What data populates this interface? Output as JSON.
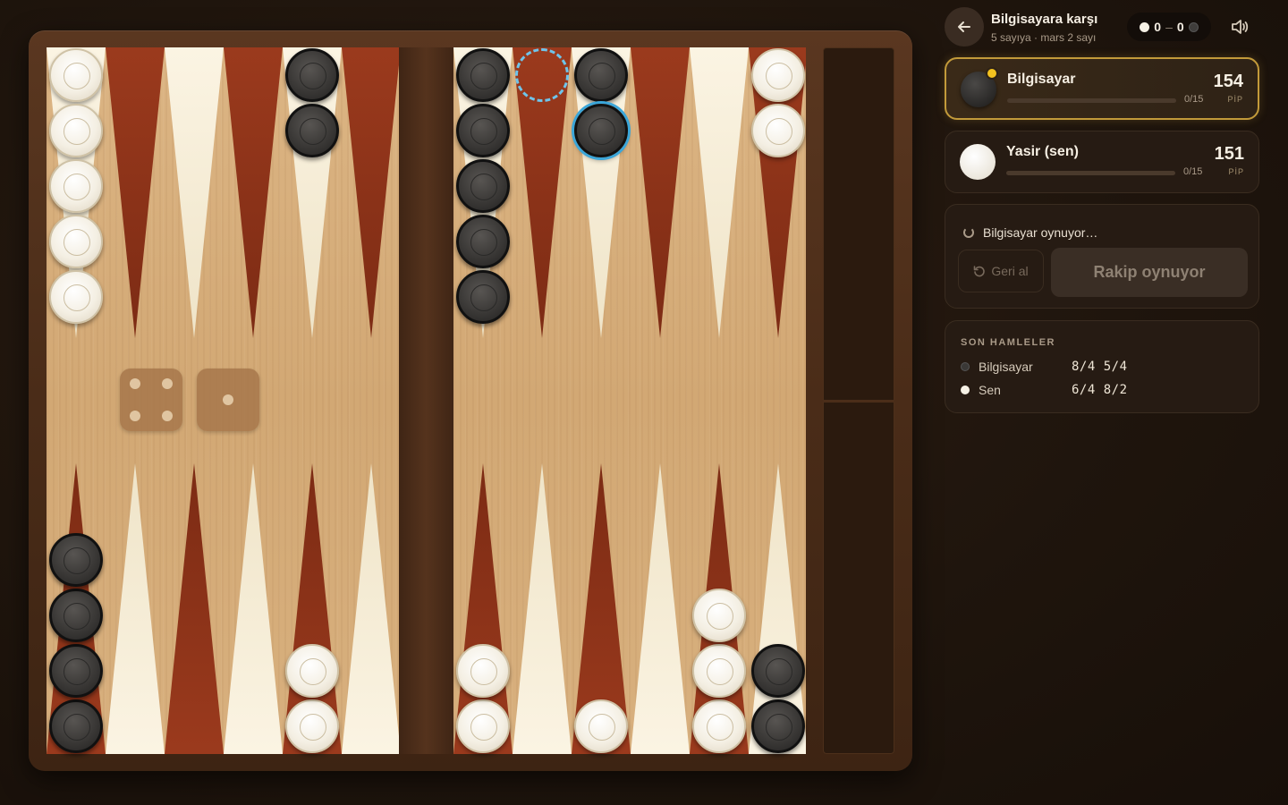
{
  "header": {
    "title": "Bilgisayara karşı",
    "subtitle": "5 sayıya · mars 2 sayı",
    "score_white": "0",
    "score_sep": "–",
    "score_black": "0"
  },
  "players": [
    {
      "name": "Bilgisayar",
      "color": "black",
      "pips": "154",
      "pip_label": "PİP",
      "borne_off": "0/15",
      "borne_fraction": 0,
      "active": true
    },
    {
      "name": "Yasir (sen)",
      "color": "white",
      "pips": "151",
      "pip_label": "PİP",
      "borne_off": "0/15",
      "borne_fraction": 0,
      "active": false
    }
  ],
  "status": {
    "text": "Bilgisayar oynuyor…",
    "undo_label": "Geri al",
    "main_button_label": "Rakip oynuyor"
  },
  "recent_moves": {
    "title": "SON HAMLELER",
    "rows": [
      {
        "player": "Bilgisayar",
        "color": "black",
        "move": "8/4 5/4"
      },
      {
        "player": "Sen",
        "color": "white",
        "move": "6/4 8/2"
      }
    ]
  },
  "dice": [
    4,
    1
  ],
  "board": {
    "top_row": [
      {
        "color": "white",
        "count": 5
      },
      {
        "color": null,
        "count": 0
      },
      {
        "color": null,
        "count": 0
      },
      {
        "color": null,
        "count": 0
      },
      {
        "color": "black",
        "count": 2
      },
      {
        "color": null,
        "count": 0
      },
      {
        "color": "black",
        "count": 5
      },
      {
        "color": null,
        "count": 0,
        "ghost": true
      },
      {
        "color": "black",
        "count": 2,
        "selected_index": 1
      },
      {
        "color": null,
        "count": 0
      },
      {
        "color": null,
        "count": 0
      },
      {
        "color": "white",
        "count": 2
      }
    ],
    "bottom_row": [
      {
        "color": "black",
        "count": 4
      },
      {
        "color": null,
        "count": 0
      },
      {
        "color": null,
        "count": 0
      },
      {
        "color": null,
        "count": 0
      },
      {
        "color": "white",
        "count": 2
      },
      {
        "color": null,
        "count": 0
      },
      {
        "color": "white",
        "count": 2
      },
      {
        "color": null,
        "count": 0
      },
      {
        "color": "white",
        "count": 1
      },
      {
        "color": null,
        "count": 0
      },
      {
        "color": "white",
        "count": 3
      },
      {
        "color": "black",
        "count": 2
      }
    ]
  },
  "colors": {
    "accent": "#c29a3a",
    "turn_indicator": "#f4c21f",
    "selection": "#3ba6d9",
    "point_dark": "#8a3218",
    "point_light": "#f7eed8"
  }
}
